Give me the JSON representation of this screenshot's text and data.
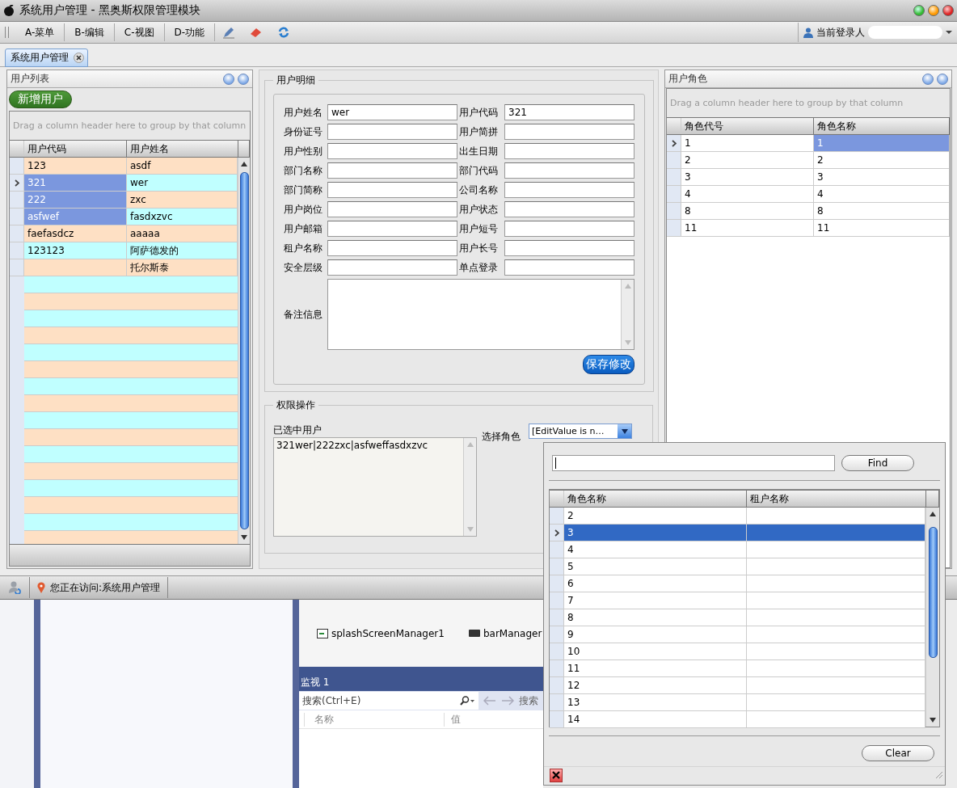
{
  "window": {
    "title": "系统用户管理 - 黑奥斯权限管理模块"
  },
  "menu": [
    "A-菜单",
    "B-编辑",
    "C-视图",
    "D-功能"
  ],
  "current_user": {
    "label": "当前登录人"
  },
  "tabs": [
    {
      "label": "系统用户管理",
      "selected": true
    }
  ],
  "user_list": {
    "title": "用户列表",
    "add_button": "新增用户",
    "group_hint": "Drag a column header here to group by that column",
    "columns": [
      "用户代码",
      "用户姓名"
    ],
    "rows": [
      {
        "code": "123",
        "name": "asdf",
        "selected": false,
        "focused": false
      },
      {
        "code": "321",
        "name": "wer",
        "selected": true,
        "focused": true
      },
      {
        "code": "222",
        "name": "zxc",
        "selected": true,
        "focused": false
      },
      {
        "code": "asfwef",
        "name": "fasdxzvc",
        "selected": true,
        "focused": false
      },
      {
        "code": "faefasdcz",
        "name": "aaaaa",
        "selected": false,
        "focused": false
      },
      {
        "code": "123123",
        "name": "阿萨德发的",
        "selected": false,
        "focused": false
      },
      {
        "name": "托尔斯泰",
        "selected": false,
        "focused": false
      }
    ]
  },
  "user_detail": {
    "title": "用户明细",
    "fields": [
      {
        "label": "用户姓名",
        "value": "wer"
      },
      {
        "label": "用户代码",
        "value": "321"
      },
      {
        "label": "身份证号"
      },
      {
        "label": "用户简拼"
      },
      {
        "label": "用户性别"
      },
      {
        "label": "出生日期"
      },
      {
        "label": "部门名称"
      },
      {
        "label": "部门代码"
      },
      {
        "label": "部门简称"
      },
      {
        "label": "公司名称"
      },
      {
        "label": "用户岗位"
      },
      {
        "label": "用户状态"
      },
      {
        "label": "用户邮箱"
      },
      {
        "label": "用户短号"
      },
      {
        "label": "租户名称"
      },
      {
        "label": "用户长号"
      },
      {
        "label": "安全层级"
      },
      {
        "label": "单点登录"
      }
    ],
    "remarks_label": "备注信息",
    "save_button": "保存修改"
  },
  "permissions": {
    "title": "权限操作",
    "selected_users_label": "已选中用户",
    "selected_users": "321wer|222zxc|asfweffasdxzvc",
    "role_label": "选择角色",
    "role_value": "[EditValue is n…"
  },
  "user_roles": {
    "title": "用户角色",
    "group_hint": "Drag a column header here to group by that column",
    "columns": [
      "角色代号",
      "角色名称"
    ],
    "rows": [
      {
        "code": "1",
        "name": "1",
        "selected": true,
        "focused": true
      },
      {
        "code": "2",
        "name": "2",
        "selected": false,
        "focused": false
      },
      {
        "code": "3",
        "name": "3",
        "selected": false,
        "focused": false
      },
      {
        "code": "4",
        "name": "4",
        "selected": false,
        "focused": false
      },
      {
        "code": "8",
        "name": "8",
        "selected": false,
        "focused": false
      },
      {
        "code": "11",
        "name": "11",
        "selected": false,
        "focused": false
      }
    ]
  },
  "role_popup": {
    "find_button": "Find",
    "columns": [
      "角色名称",
      "租户名称"
    ],
    "rows": [
      {
        "name": "2",
        "selected": false
      },
      {
        "name": "3",
        "selected": true
      },
      {
        "name": "4",
        "selected": false
      },
      {
        "name": "5",
        "selected": false
      },
      {
        "name": "6",
        "selected": false
      },
      {
        "name": "7",
        "selected": false
      },
      {
        "name": "8",
        "selected": false
      },
      {
        "name": "9",
        "selected": false
      },
      {
        "name": "10",
        "selected": false
      },
      {
        "name": "11",
        "selected": false
      },
      {
        "name": "12",
        "selected": false
      },
      {
        "name": "13",
        "selected": false
      },
      {
        "name": "14",
        "selected": false
      }
    ],
    "clear_button": "Clear"
  },
  "status_bar": {
    "location": "您正在访问:系统用户管理"
  },
  "ide_background": {
    "components": [
      "splashScreenManager1",
      "barManager"
    ],
    "watch": {
      "title": "监视 1",
      "search_placeholder": "搜索(Ctrl+E)",
      "search_label": "搜索",
      "columns": [
        "名称",
        "值"
      ]
    }
  }
}
